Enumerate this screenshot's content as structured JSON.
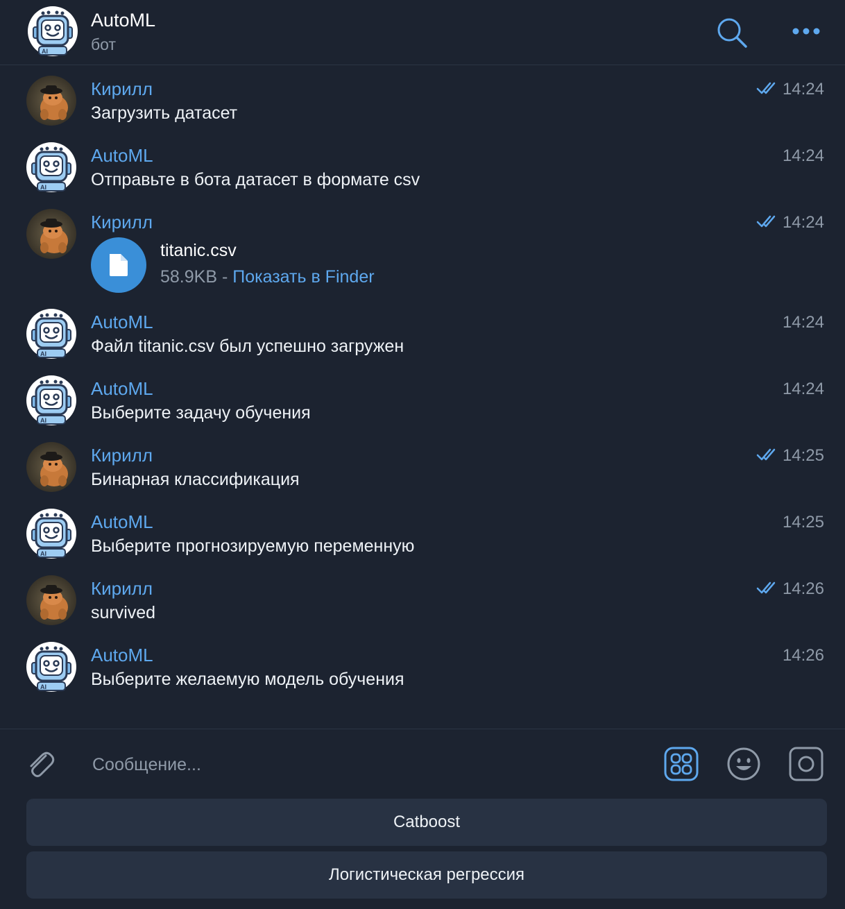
{
  "header": {
    "title": "AutoML",
    "subtitle": "бот"
  },
  "messages": [
    {
      "sender": "Кирилл",
      "text": "Загрузить датасет",
      "time": "14:24",
      "read": true
    },
    {
      "sender": "AutoML",
      "text": "Отправьте в бота датасет в формате csv",
      "time": "14:24",
      "read": false
    },
    {
      "sender": "Кирилл",
      "time": "14:24",
      "read": true,
      "file": {
        "name": "titanic.csv",
        "size": "58.9KB",
        "separator": " - ",
        "action": "Показать в Finder"
      }
    },
    {
      "sender": "AutoML",
      "text": "Файл titanic.csv был успешно загружен",
      "time": "14:24",
      "read": false
    },
    {
      "sender": "AutoML",
      "text": "Выберите задачу обучения",
      "time": "14:24",
      "read": false
    },
    {
      "sender": "Кирилл",
      "text": "Бинарная классификация",
      "time": "14:25",
      "read": true
    },
    {
      "sender": "AutoML",
      "text": "Выберите прогнозируемую переменную",
      "time": "14:25",
      "read": false
    },
    {
      "sender": "Кирилл",
      "text": "survived",
      "time": "14:26",
      "read": true
    },
    {
      "sender": "AutoML",
      "text": "Выберите желаемую модель обучения",
      "time": "14:26",
      "read": false
    }
  ],
  "composer": {
    "placeholder": "Сообщение...",
    "value": ""
  },
  "keyboard": {
    "buttons": [
      "Catboost",
      "Логистическая регрессия"
    ]
  },
  "icons": {
    "search": "search-icon",
    "more": "more-icon",
    "attach": "paperclip-icon",
    "commands": "bot-commands-icon",
    "emoji": "emoji-icon",
    "camera": "camera-icon",
    "read": "double-check-icon",
    "file": "document-icon"
  },
  "colors": {
    "background": "#1c2330",
    "accent": "#5ea8ee",
    "file_circle": "#3a8fd8",
    "muted": "#8f9aa8",
    "keyboard_button": "#283243"
  }
}
